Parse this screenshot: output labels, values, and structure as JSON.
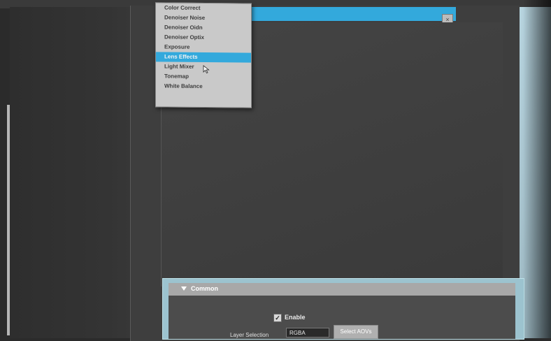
{
  "context_menu": {
    "items": [
      {
        "label": "Color Correct"
      },
      {
        "label": "Denoiser Noise"
      },
      {
        "label": "Denoiser Oidn"
      },
      {
        "label": "Denoiser Optix"
      },
      {
        "label": "Exposure"
      },
      {
        "label": "Lens Effects",
        "selected": true
      },
      {
        "label": "Light Mixer"
      },
      {
        "label": "Tonemap"
      },
      {
        "label": "White Balance"
      }
    ]
  },
  "layer_panel": {
    "title": "Common",
    "enable_label": "Enable",
    "enable_checked": true,
    "layer_selection_label": "Layer Selection",
    "layer_selection_value": "RGBA",
    "select_button_label": "Select AOVs"
  },
  "colors": {
    "accent": "#33a9dc",
    "panel_bg": "#3e3e3e",
    "menu_bg": "#c9c9c9"
  }
}
